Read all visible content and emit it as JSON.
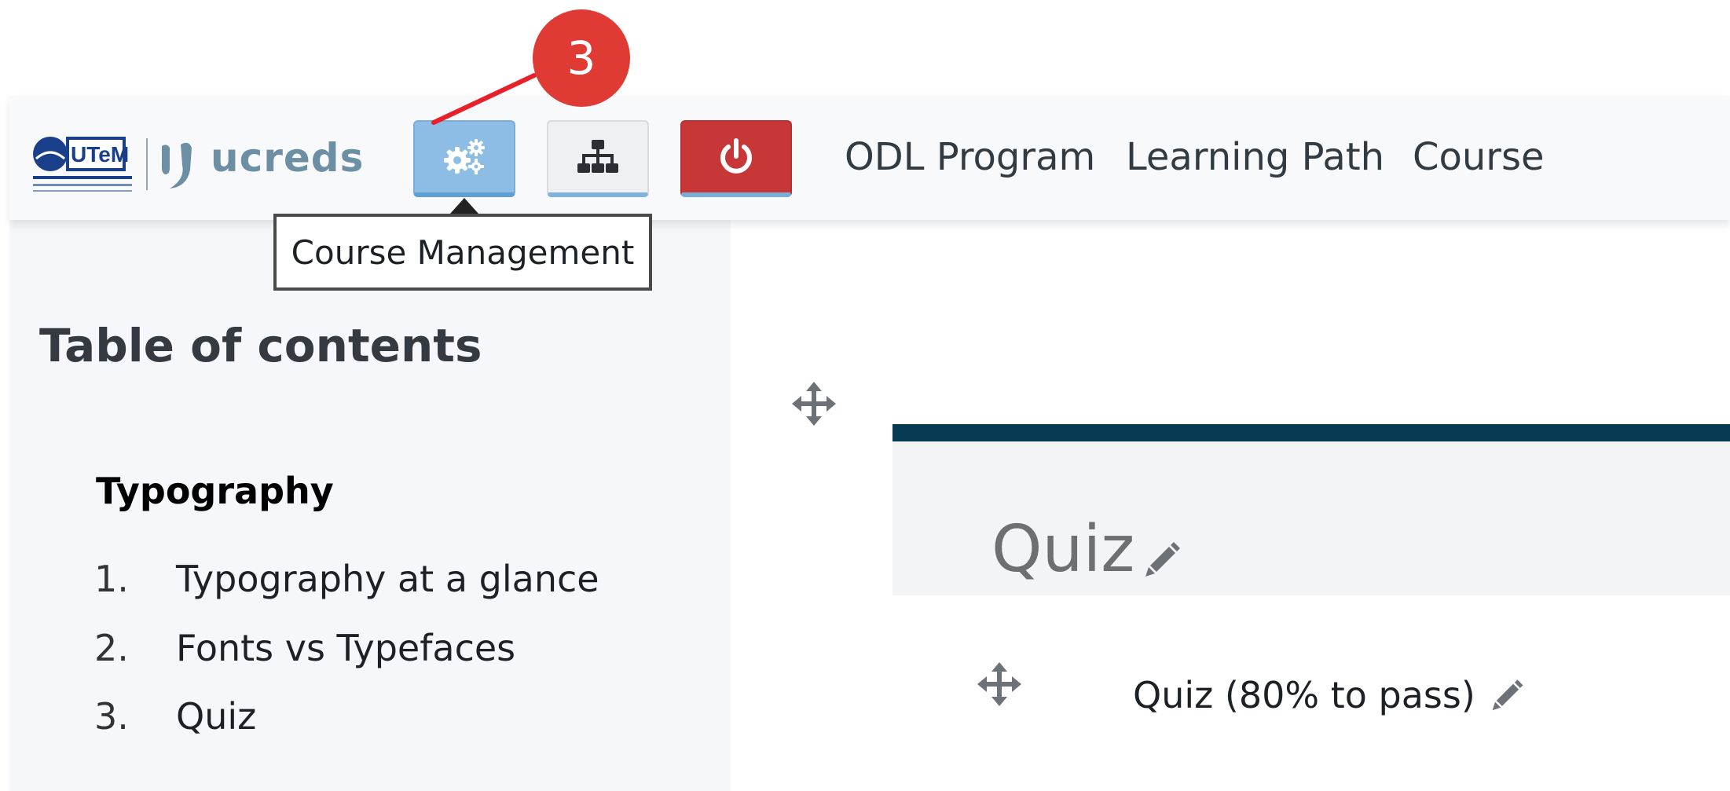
{
  "callout": {
    "number": "3",
    "color": "#e03a34"
  },
  "navbar": {
    "logo_text": "ucreds",
    "logo_badge_text": "UTeM",
    "buttons": [
      {
        "icon": "gears-icon",
        "color": "#8dbde4"
      },
      {
        "icon": "sitemap-icon",
        "color": "#eef0f2"
      },
      {
        "icon": "power-icon",
        "color": "#c83738"
      }
    ],
    "links": {
      "odl": "ODL Program",
      "learning_path": "Learning Path",
      "course": "Course"
    }
  },
  "tooltip": {
    "text": "Course Management"
  },
  "sidebar": {
    "title": "Table of contents",
    "section": "Typography",
    "items": [
      {
        "num": "1.",
        "label": "Typography at a glance"
      },
      {
        "num": "2.",
        "label": "Fonts vs Typefaces"
      },
      {
        "num": "3.",
        "label": "Quiz"
      }
    ]
  },
  "main": {
    "section_title": "Quiz",
    "activity": "Quiz (80% to pass)",
    "accent_color": "#053a52"
  }
}
